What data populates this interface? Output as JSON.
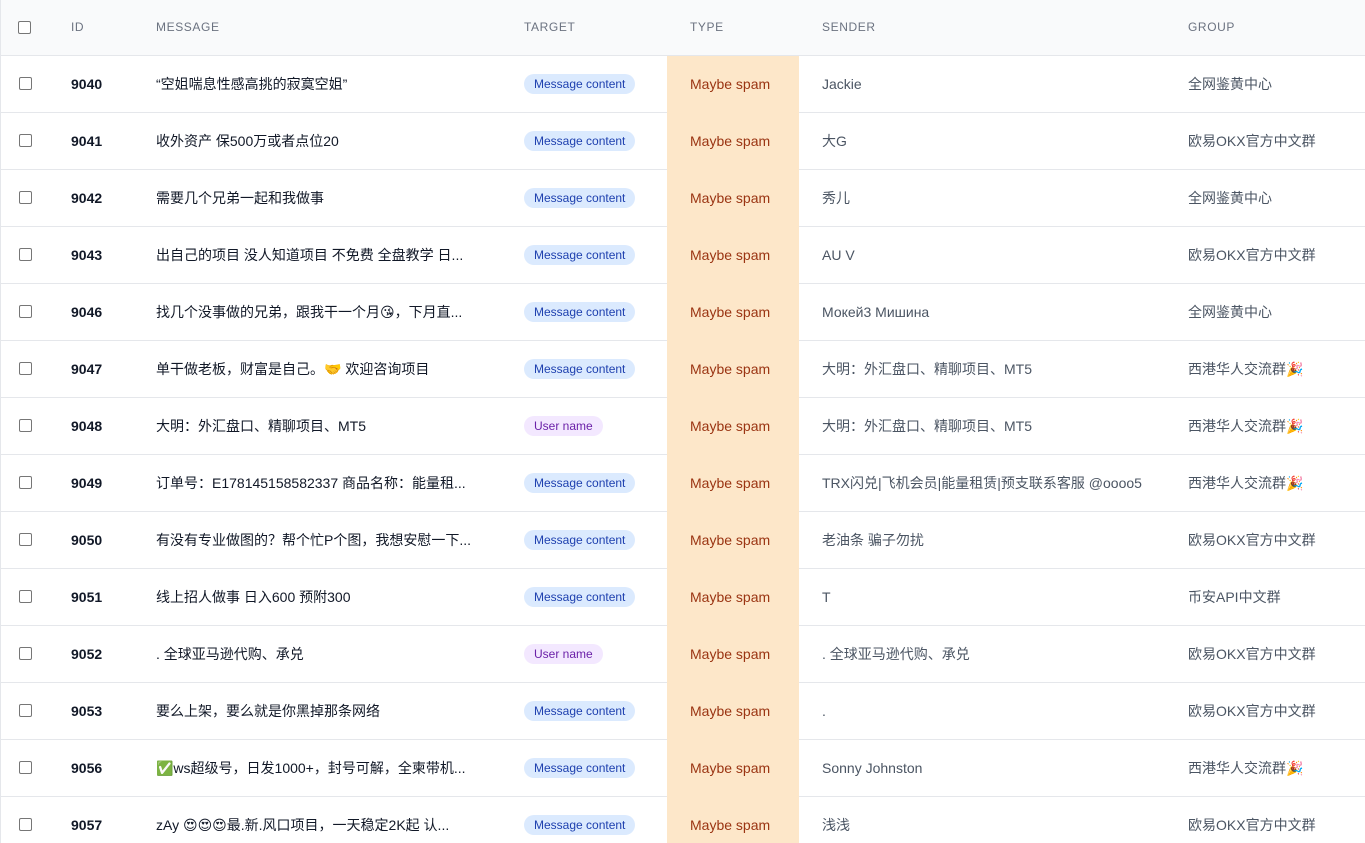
{
  "headers": {
    "id": "ID",
    "message": "MESSAGE",
    "target": "TARGET",
    "type": "TYPE",
    "sender": "SENDER",
    "group": "GROUP"
  },
  "colors": {
    "type_highlight": "#fde7c9",
    "type_text": "#9a3412",
    "badge_blue_bg": "#dbeafe",
    "badge_purple_bg": "#f3e8ff"
  },
  "rows": [
    {
      "id": "9040",
      "message": "“空姐喘息性感高挑的寂寞空姐”",
      "target": "Message content",
      "target_kind": "blue",
      "type": "Maybe spam",
      "sender": "Jackie",
      "group": "全网鉴黄中心"
    },
    {
      "id": "9041",
      "message": "收外资产 保500万或者点位20",
      "target": "Message content",
      "target_kind": "blue",
      "type": "Maybe spam",
      "sender": "大G",
      "group": "欧易OKX官方中文群"
    },
    {
      "id": "9042",
      "message": "需要几个兄弟一起和我做事",
      "target": "Message content",
      "target_kind": "blue",
      "type": "Maybe spam",
      "sender": "秀儿",
      "group": "全网鉴黄中心"
    },
    {
      "id": "9043",
      "message": "出自己的项目 没人知道项目 不免费 全盘教学 日...",
      "target": "Message content",
      "target_kind": "blue",
      "type": "Maybe spam",
      "sender": "AU V",
      "group": "欧易OKX官方中文群"
    },
    {
      "id": "9046",
      "message": "找几个没事做的兄弟，跟我干一个月😘，下月直...",
      "target": "Message content",
      "target_kind": "blue",
      "type": "Maybe spam",
      "sender": "Мокей3 Мишина",
      "group": "全网鉴黄中心"
    },
    {
      "id": "9047",
      "message": "单干做老板，财富是自己。🤝 欢迎咨询项目",
      "target": "Message content",
      "target_kind": "blue",
      "type": "Maybe spam",
      "sender": "大明：外汇盘口、精聊项目、MT5",
      "group": "西港华人交流群🎉"
    },
    {
      "id": "9048",
      "message": "大明：外汇盘口、精聊项目、MT5",
      "target": "User name",
      "target_kind": "purple",
      "type": "Maybe spam",
      "sender": "大明：外汇盘口、精聊项目、MT5",
      "group": "西港华人交流群🎉"
    },
    {
      "id": "9049",
      "message": "订单号：E178145158582337 商品名称：能量租...",
      "target": "Message content",
      "target_kind": "blue",
      "type": "Maybe spam",
      "sender": "TRX闪兑|飞机会员|能量租赁|预支联系客服 @oooo5",
      "group": "西港华人交流群🎉"
    },
    {
      "id": "9050",
      "message": "有没有专业做图的？帮个忙P个图，我想安慰一下...",
      "target": "Message content",
      "target_kind": "blue",
      "type": "Maybe spam",
      "sender": "老油条 骗子勿扰",
      "group": "欧易OKX官方中文群"
    },
    {
      "id": "9051",
      "message": "线上招人做事 日入600 预附300",
      "target": "Message content",
      "target_kind": "blue",
      "type": "Maybe spam",
      "sender": "T",
      "group": "币安API中文群"
    },
    {
      "id": "9052",
      "message": ". 全球亚马逊代购、承兑",
      "target": "User name",
      "target_kind": "purple",
      "type": "Maybe spam",
      "sender": ". 全球亚马逊代购、承兑",
      "group": "欧易OKX官方中文群"
    },
    {
      "id": "9053",
      "message": "要么上架，要么就是你黑掉那条网络",
      "target": "Message content",
      "target_kind": "blue",
      "type": "Maybe spam",
      "sender": ".",
      "group": "欧易OKX官方中文群"
    },
    {
      "id": "9056",
      "message": "✅ws超级号，日发1000+，封号可解，全柬带机...",
      "target": "Message content",
      "target_kind": "blue",
      "type": "Maybe spam",
      "sender": "Sonny Johnston",
      "group": "西港华人交流群🎉"
    },
    {
      "id": "9057",
      "message": "zAy 😍😍😍最.新.风口项目，一天稳定2K起 认...",
      "target": "Message content",
      "target_kind": "blue",
      "type": "Maybe spam",
      "sender": "浅浅",
      "group": "欧易OKX官方中文群"
    }
  ]
}
